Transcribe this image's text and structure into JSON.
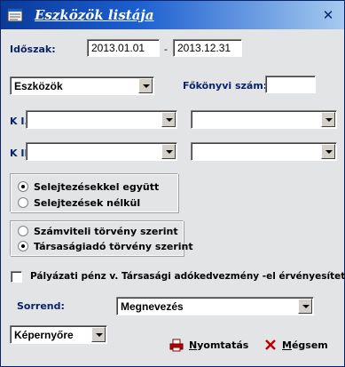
{
  "window": {
    "title": "Eszközök listája",
    "close_symbol": "✕"
  },
  "period": {
    "label": "Időszak:",
    "from": "2013.01.01",
    "separator": "-",
    "to": "2013.12.31"
  },
  "category": {
    "selected": "Eszközök"
  },
  "ledger": {
    "label": "Főkönyvi szám:",
    "value": ""
  },
  "k1": {
    "label": "K I.",
    "left": "",
    "right": ""
  },
  "k2": {
    "label": "K II.",
    "left": "",
    "right": ""
  },
  "discard": {
    "options": [
      "Selejtezésekkel együtt",
      "Selejtezések nélkül"
    ],
    "selected_index": 0
  },
  "law": {
    "options": [
      "Számviteli törvény szerint",
      "Társaságiadó törvény szerint"
    ],
    "selected_index": 1
  },
  "grant": {
    "label": "Pályázati pénz v. Társasági adókedvezmény -el érvényesített",
    "checked": false
  },
  "sort": {
    "label": "Sorrend:",
    "selected": "Megnevezés"
  },
  "output": {
    "selected": "Képernyőre"
  },
  "buttons": {
    "print": {
      "label_first": "N",
      "label_rest": "yomtatás"
    },
    "cancel": {
      "label_first": "M",
      "label_rest": "égsem"
    }
  },
  "icons": {
    "app": "document-icon",
    "print": "printer-icon",
    "cancel": "x-mark-icon",
    "close": "close-icon"
  },
  "colors": {
    "title_bar": "#1c5fd0",
    "label_blue": "#0a246a",
    "cancel_red": "#c00000"
  }
}
